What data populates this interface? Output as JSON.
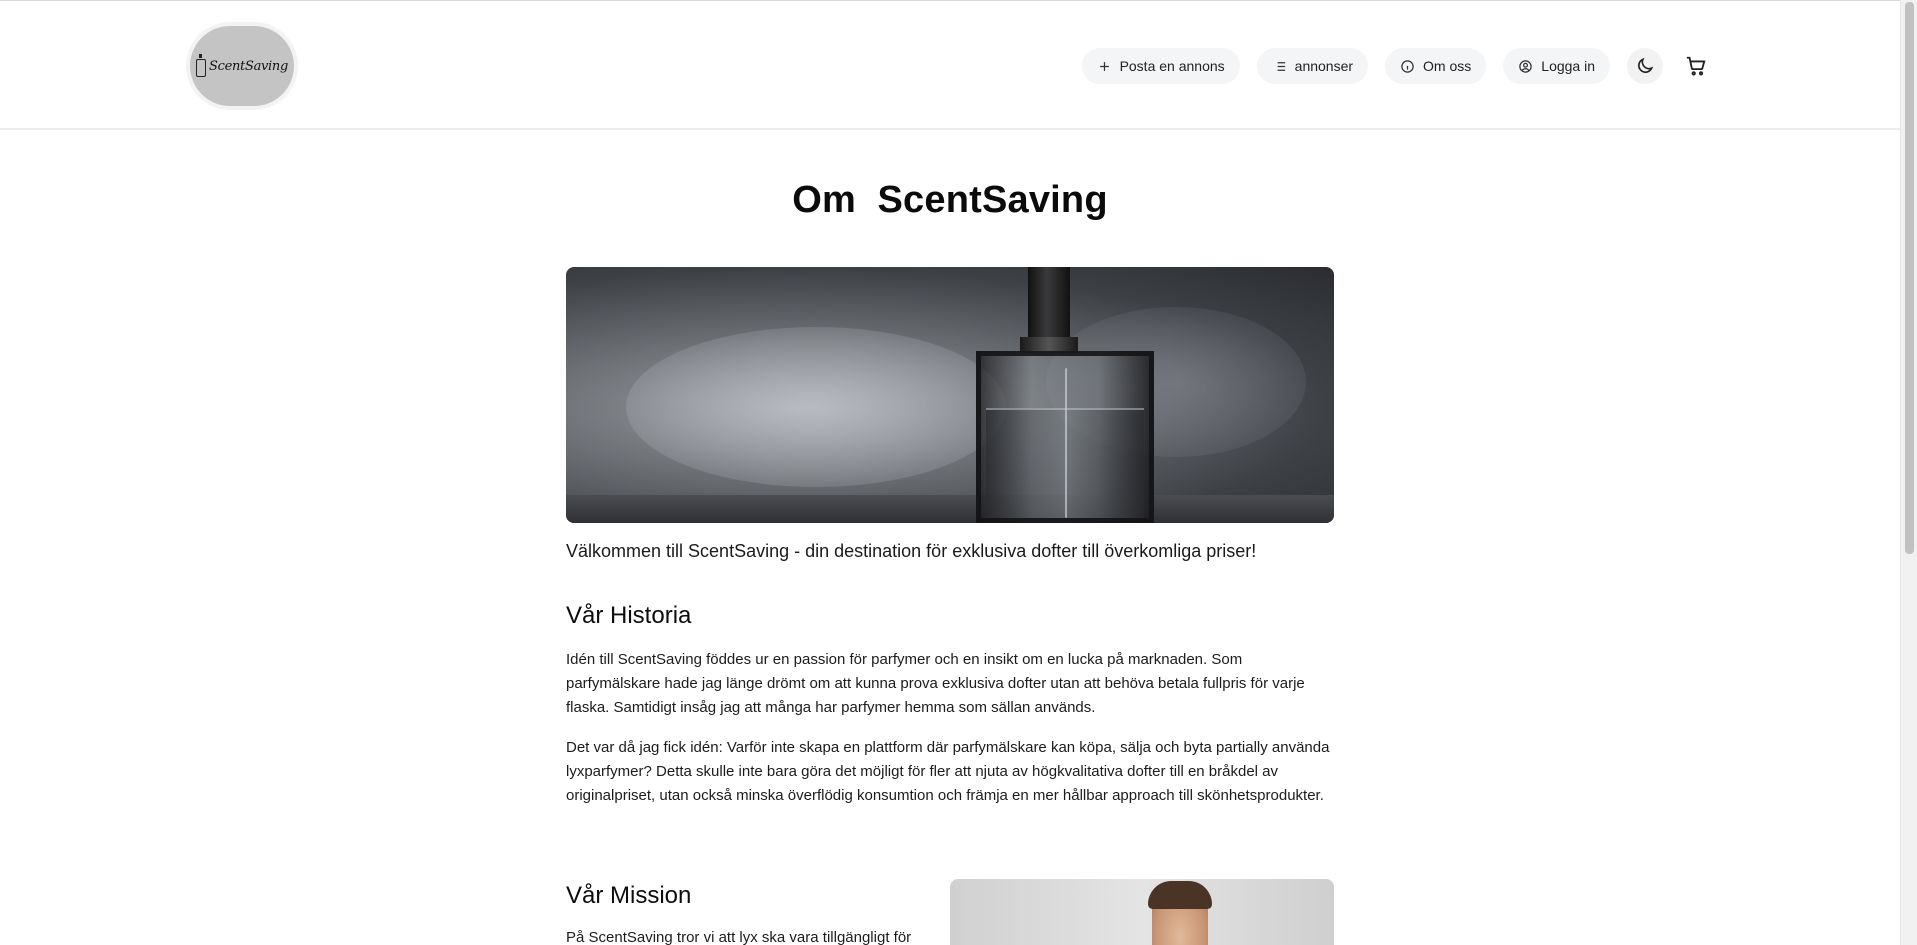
{
  "header": {
    "logo_text": "ScentSaving",
    "nav": {
      "post_ad": "Posta en annons",
      "listings": "annonser",
      "about": "Om oss",
      "login": "Logga in"
    },
    "icons": {
      "post_ad": "plus-icon",
      "listings": "list-icon",
      "about": "info-icon",
      "login": "user-circle-icon",
      "theme": "moon-icon",
      "cart": "cart-icon"
    }
  },
  "main": {
    "title": "Om  ScentSaving",
    "lead": "Välkommen till ScentSaving - din destination för exklusiva dofter till överkomliga priser!",
    "history": {
      "heading": "Vår Historia",
      "p1": "Idén till ScentSaving föddes ur en passion för parfymer och en insikt om en lucka på marknaden. Som parfymälskare hade jag länge drömt om att kunna prova exklusiva dofter utan att behöva betala fullpris för varje flaska. Samtidigt insåg jag att många har parfymer hemma som sällan används.",
      "p2": "Det var då jag fick idén: Varför inte skapa en plattform där parfymälskare kan köpa, sälja och byta partially använda lyxparfymer? Detta skulle inte bara göra det möjligt för fler att njuta av högkvalitativa dofter till en bråkdel av originalpriset, utan också minska överflödig konsumtion och främja en mer hållbar approach till skönhetsprodukter."
    },
    "mission": {
      "heading": "Vår Mission",
      "text": "På ScentSaving tror vi att lyx ska vara tillgängligt för"
    }
  }
}
